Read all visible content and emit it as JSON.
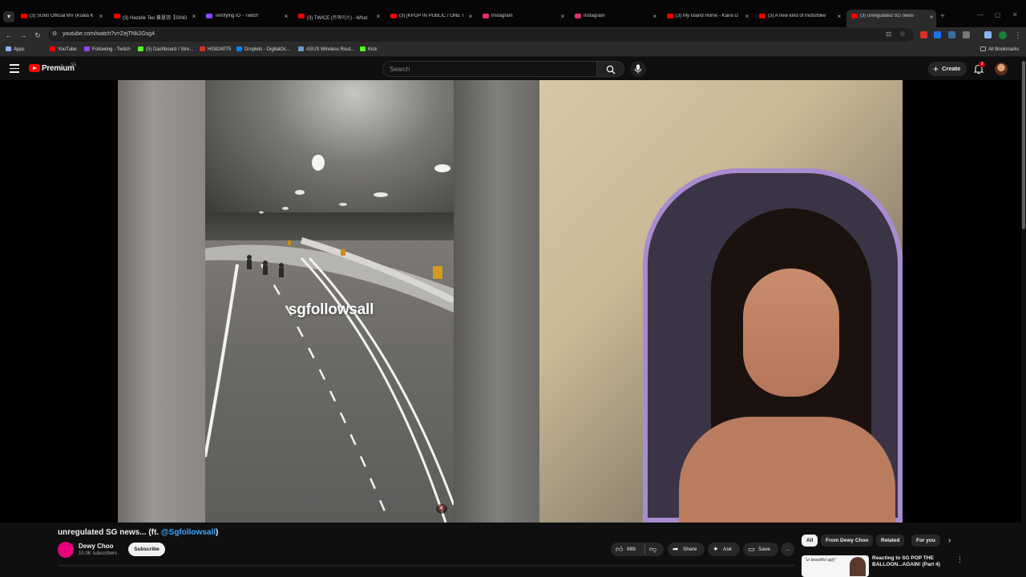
{
  "browser": {
    "tabs": [
      {
        "title": "(3) SG60 Official MV (Koala K",
        "color": "#ff0000",
        "active": false
      },
      {
        "title": "(3) Hazelle Teo 黄慧羽【SING",
        "color": "#ff0000",
        "active": false
      },
      {
        "title": "Terrifying iO - Twitch",
        "color": "#9146ff",
        "active": false
      },
      {
        "title": "(3) TWICE (트와이스) - What",
        "color": "#ff0000",
        "active": false
      },
      {
        "title": "(3) [KPOP IN PUBLIC / ONE T",
        "color": "#ff0000",
        "active": false
      },
      {
        "title": "Instagram",
        "color": "#e1306c",
        "active": false
      },
      {
        "title": "Instagram",
        "color": "#e1306c",
        "active": false
      },
      {
        "title": "(3) My Island Home - Kaira G",
        "color": "#ff0000",
        "active": false
      },
      {
        "title": "(3) A new kind of motorbike",
        "color": "#ff0000",
        "active": false
      },
      {
        "title": "(3) unregulated SG news",
        "color": "#ff0000",
        "active": true
      }
    ],
    "new_tab": "+",
    "url": "youtube.com/watch?v=ZejTNk2Gsg4",
    "bookmarks": [
      {
        "label": "Apps",
        "color": "#8ab4f8"
      },
      {
        "label": "YouTube",
        "color": "#ff0000"
      },
      {
        "label": "Following - Twitch",
        "color": "#9146ff"
      },
      {
        "label": "(5) Dashboard / Stre...",
        "color": "#53fc18"
      },
      {
        "label": "HG8240T5",
        "color": "#d93025"
      },
      {
        "label": "Droplets - DigitalOc...",
        "color": "#0080ff"
      },
      {
        "label": "ASUS Wireless Rout...",
        "color": "#6b9bd2"
      },
      {
        "label": "Kick",
        "color": "#53fc18"
      }
    ],
    "all_bookmarks": "All Bookmarks"
  },
  "masthead": {
    "brand": "Premium",
    "brand_sup": "SG",
    "search_placeholder": "Search",
    "create_label": "Create",
    "notification_count": "3"
  },
  "video": {
    "overlay_text": "sgfollowsall"
  },
  "below": {
    "title_text": "unregulated SG news... (ft. ",
    "title_mention": "@Sgfollowsall",
    "title_end": ")",
    "channel_name": "Dewy Choo",
    "subscribers": "10.3K subscribers",
    "subscribe_label": "Subscribe",
    "like_count": "989",
    "share_label": "Share",
    "ask_label": "Ask",
    "save_label": "Save",
    "more_label": "..."
  },
  "sidebar": {
    "chips": [
      "All",
      "From Dewy Choo",
      "Related",
      "For you"
    ],
    "rec_thumb_caption": "\"ur beautiful ugly\"",
    "rec_title": "Reacting to SG POP THE BALLOON...AGAIN! (Part 4)"
  }
}
